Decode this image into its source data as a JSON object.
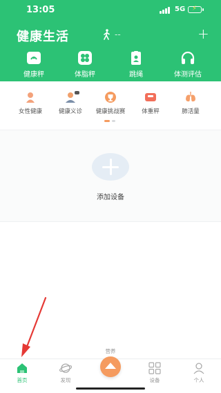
{
  "status": {
    "time": "13:05",
    "network": "5G"
  },
  "header": {
    "title": "健康生活",
    "steps": "--",
    "add": "+"
  },
  "devices": [
    {
      "label": "健康秤",
      "icon": "scale-icon"
    },
    {
      "label": "体脂秤",
      "icon": "body-fat-scale-icon"
    },
    {
      "label": "跳绳",
      "icon": "jump-rope-icon"
    },
    {
      "label": "体测评估",
      "icon": "headphones-icon"
    }
  ],
  "features": [
    {
      "label": "女性健康",
      "icon": "female-health-icon",
      "color": "#f3a27b"
    },
    {
      "label": "健康义诊",
      "icon": "doctor-icon",
      "color": "#f0a06c"
    },
    {
      "label": "健康挑战赛",
      "icon": "trophy-icon",
      "color": "#f59b5f"
    },
    {
      "label": "体重秤",
      "icon": "weight-scale-icon",
      "color": "#f26f5a"
    },
    {
      "label": "肺活量",
      "icon": "lungs-icon",
      "color": "#f5a06b"
    }
  ],
  "add_device": {
    "label": "添加设备"
  },
  "tabs": [
    {
      "label": "首页",
      "icon": "home-icon"
    },
    {
      "label": "发现",
      "icon": "planet-icon"
    },
    {
      "label": "设备",
      "icon": "devices-icon"
    },
    {
      "label": "个人",
      "icon": "profile-icon"
    }
  ],
  "center_tab": {
    "label": "营养"
  },
  "colors": {
    "brand": "#2cc275",
    "accent": "#f59b5f",
    "annotation": "#e53935"
  }
}
